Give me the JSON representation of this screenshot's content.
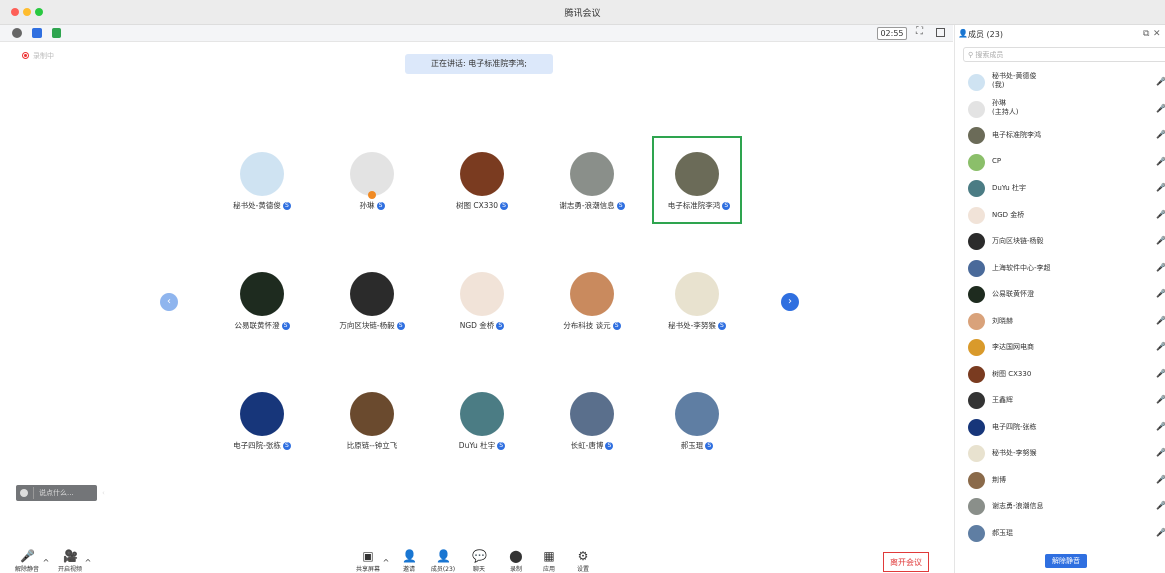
{
  "window": {
    "title": "腾讯会议"
  },
  "infobar": {
    "timer": "02:55"
  },
  "stage": {
    "recording_label": "录制中",
    "speaking": "正在讲话: 电子标准院李鸿;"
  },
  "participants": [
    {
      "name": "秘书处-黄德俊",
      "color": "#cfe3f2"
    },
    {
      "name": "孙琳",
      "color": "#e3e3e3"
    },
    {
      "name": "树图 CX330",
      "color": "#7a3b20"
    },
    {
      "name": "谢志勇-浪潮信息",
      "color": "#8a8f8a"
    },
    {
      "name": "电子标准院李鸿",
      "color": "#6b6b58"
    },
    {
      "name": "公易联黄怀澄",
      "color": "#1e2b1f"
    },
    {
      "name": "万向区块链-杨毅",
      "color": "#2b2b2b"
    },
    {
      "name": "NGD 金桥",
      "color": "#f1e3d8"
    },
    {
      "name": "分布科技 谈元",
      "color": "#c98a5e"
    },
    {
      "name": "秘书处-李努猴",
      "color": "#e8e2cf"
    },
    {
      "name": "电子四院-张栋",
      "color": "#17367a"
    },
    {
      "name": "比原链--钟立飞",
      "color": "#6a4a2e"
    },
    {
      "name": "DuYu 杜宇",
      "color": "#4b7c84"
    },
    {
      "name": "长虹-唐博",
      "color": "#5a6f8c"
    },
    {
      "name": "郝玉琨",
      "color": "#5f7ea3"
    }
  ],
  "chat": {
    "placeholder": "说点什么..."
  },
  "toolbar": {
    "unmute": "解除静音",
    "start_video": "开启视频",
    "share_screen": "共享屏幕",
    "invite": "邀请",
    "members": "成员(23)",
    "chat": "聊天",
    "record": "录制",
    "apps": "应用",
    "settings": "设置",
    "leave": "离开会议"
  },
  "panel": {
    "title": "成员 (23)",
    "search_placeholder": "搜索成员",
    "unmute_all": "解除静音",
    "members": [
      {
        "name": "秘书处-黄德俊",
        "sub": "(我)",
        "color": "#cfe3f2"
      },
      {
        "name": "孙琳",
        "sub": "(主持人)",
        "color": "#e3e3e3"
      },
      {
        "name": "电子标准院李鸿",
        "sub": "",
        "color": "#6b6b58"
      },
      {
        "name": "CP",
        "sub": "",
        "color": "#8bbf6a"
      },
      {
        "name": "DuYu 杜宇",
        "sub": "",
        "color": "#4b7c84"
      },
      {
        "name": "NGD 金桥",
        "sub": "",
        "color": "#f1e3d8"
      },
      {
        "name": "万向区块链-杨毅",
        "sub": "",
        "color": "#2b2b2b"
      },
      {
        "name": "上海软件中心-李超",
        "sub": "",
        "color": "#4a6a9a"
      },
      {
        "name": "公易联黄怀澄",
        "sub": "",
        "color": "#1e2b1f"
      },
      {
        "name": "刘晓赫",
        "sub": "",
        "color": "#d9a27a"
      },
      {
        "name": "李达国网电商",
        "sub": "",
        "color": "#d99a2b"
      },
      {
        "name": "树图 CX330",
        "sub": "",
        "color": "#7a3b20"
      },
      {
        "name": "王鑫辉",
        "sub": "",
        "color": "#333333"
      },
      {
        "name": "电子四院-张栋",
        "sub": "",
        "color": "#17367a"
      },
      {
        "name": "秘书处-李努猴",
        "sub": "",
        "color": "#e8e2cf"
      },
      {
        "name": "荆博",
        "sub": "",
        "color": "#8a6a4a"
      },
      {
        "name": "谢志勇-浪潮信息",
        "sub": "",
        "color": "#8a8f8a"
      },
      {
        "name": "郝玉琨",
        "sub": "",
        "color": "#5f7ea3"
      }
    ]
  }
}
